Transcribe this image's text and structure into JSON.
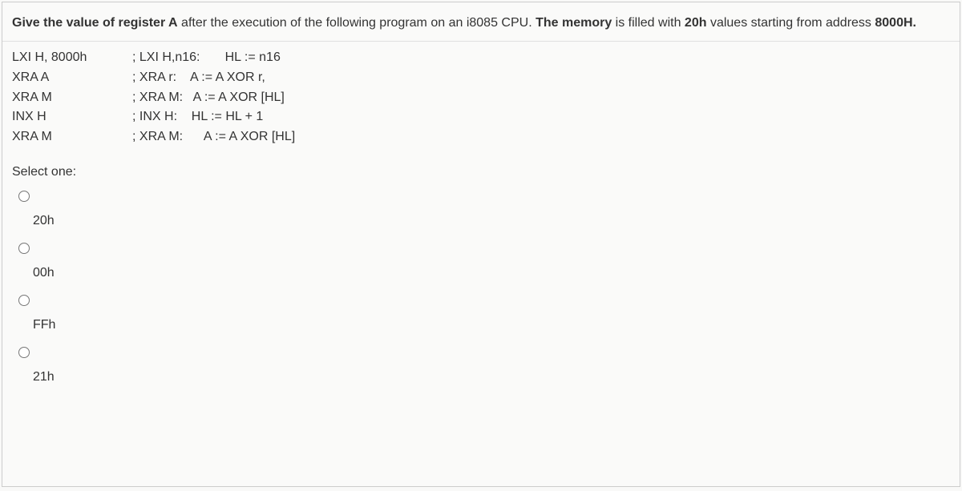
{
  "prompt": {
    "t1": "Give the value of register A",
    "t2": " after the execution of the following program on an i8085 CPU. ",
    "t3": "The memory",
    "t4": " is filled with ",
    "t5": "20h",
    "t6": " values starting from address ",
    "t7": "8000H."
  },
  "code": [
    {
      "c1": "LXI H, 8000h",
      "c2": "; LXI H,n16:       HL := n16"
    },
    {
      "c1": "XRA A",
      "c2": "; XRA r:    A := A XOR r,"
    },
    {
      "c1": "XRA M",
      "c2": "; XRA M:   A := A XOR [HL]"
    },
    {
      "c1": "INX H",
      "c2": "; INX H:    HL := HL + 1"
    },
    {
      "c1": "XRA M",
      "c2": "; XRA M:      A := A XOR [HL]"
    }
  ],
  "select_label": "Select one:",
  "options": [
    "20h",
    "00h",
    "FFh",
    "21h"
  ]
}
